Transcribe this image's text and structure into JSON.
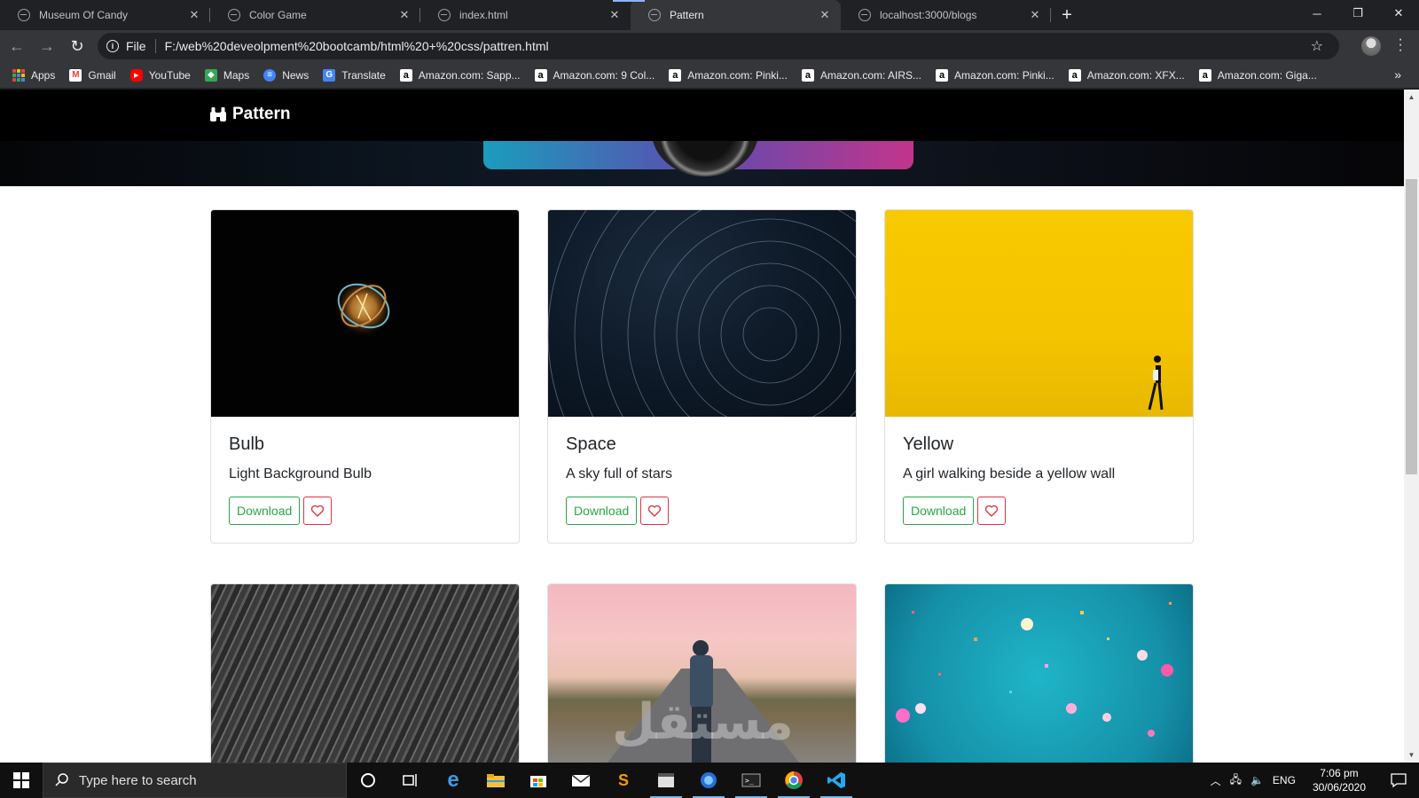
{
  "browser": {
    "tabs": [
      {
        "title": "Museum Of Candy",
        "active": false
      },
      {
        "title": "Color Game",
        "active": false
      },
      {
        "title": "index.html",
        "active": false
      },
      {
        "title": "Pattern",
        "active": true
      },
      {
        "title": "localhost:3000/blogs",
        "active": false
      }
    ],
    "new_tab": "+",
    "window_controls": {
      "minimize": "─",
      "restore": "❐",
      "close": "✕"
    },
    "toolbar": {
      "back": "←",
      "forward": "→",
      "reload": "↻",
      "scheme": "File",
      "url": "F:/web%20deveolpment%20bootcamb/html%20+%20css/pattren.html"
    },
    "bookmarks": [
      {
        "label": "Apps",
        "icon": "apps-icon"
      },
      {
        "label": "Gmail",
        "icon": "gmail-icon"
      },
      {
        "label": "YouTube",
        "icon": "youtube-icon"
      },
      {
        "label": "Maps",
        "icon": "maps-icon"
      },
      {
        "label": "News",
        "icon": "news-icon"
      },
      {
        "label": "Translate",
        "icon": "translate-icon"
      },
      {
        "label": "Amazon.com: Sapp...",
        "icon": "amazon-icon"
      },
      {
        "label": "Amazon.com: 9 Col...",
        "icon": "amazon-icon"
      },
      {
        "label": "Amazon.com: Pinki...",
        "icon": "amazon-icon"
      },
      {
        "label": "Amazon.com: AIRS...",
        "icon": "amazon-icon"
      },
      {
        "label": "Amazon.com: Pinki...",
        "icon": "amazon-icon"
      },
      {
        "label": "Amazon.com: XFX...",
        "icon": "amazon-icon"
      },
      {
        "label": "Amazon.com: Giga...",
        "icon": "amazon-icon"
      }
    ],
    "bookmarks_more": "»"
  },
  "page": {
    "brand": "Pattern",
    "cards": [
      {
        "title": "Bulb",
        "text": "Light Background Bulb",
        "download": "Download"
      },
      {
        "title": "Space",
        "text": "A sky full of stars",
        "download": "Download"
      },
      {
        "title": "Yellow",
        "text": "A girl walking beside a yellow wall",
        "download": "Download"
      }
    ],
    "watermark": "مستقل"
  },
  "taskbar": {
    "search_placeholder": "Type here to search",
    "language": "ENG",
    "time": "7:06 pm",
    "date": "30/06/2020"
  },
  "colors": {
    "success": "#28a745",
    "danger": "#dc3545",
    "navbar": "#000000"
  }
}
